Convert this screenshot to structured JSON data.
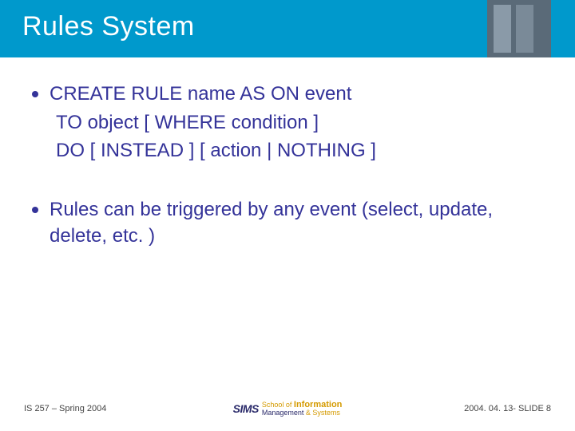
{
  "title": "Rules System",
  "bullets": [
    {
      "lead": "CREATE RULE name AS ON event",
      "subs": [
        "TO object [ WHERE condition ]",
        "DO [ INSTEAD ] [ action | NOTHING ]"
      ]
    },
    {
      "lead": "Rules can be triggered by any event (select, update, delete, etc. )",
      "subs": []
    }
  ],
  "footer": {
    "left": "IS 257 – Spring 2004",
    "logo_main": "SIMS",
    "logo_school": "School of",
    "logo_info": "Information",
    "logo_mgmt": "Management",
    "logo_sys": "& Systems",
    "right": "2004. 04. 13- SLIDE 8"
  }
}
